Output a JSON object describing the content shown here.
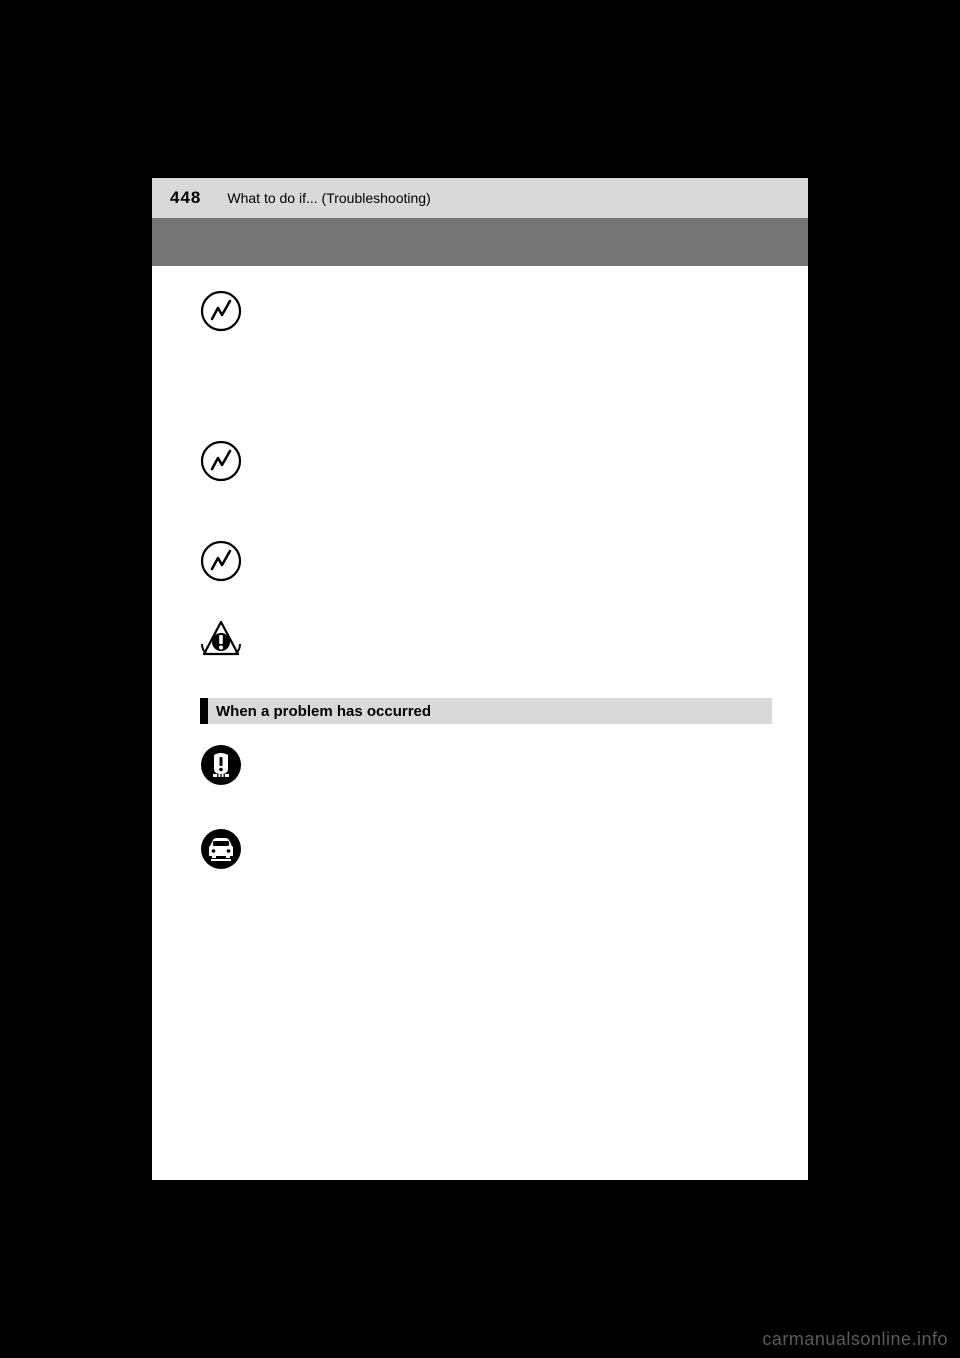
{
  "header": {
    "page_number": "448",
    "title": "What to do if... (Troubleshooting)"
  },
  "section": {
    "heading": "When a problem has occurred"
  },
  "icons": {
    "power": "power-icon",
    "master_warning": "master-warning-icon",
    "tire": "tire-icon",
    "car": "car-icon"
  },
  "watermark": "carmanualsonline.info"
}
